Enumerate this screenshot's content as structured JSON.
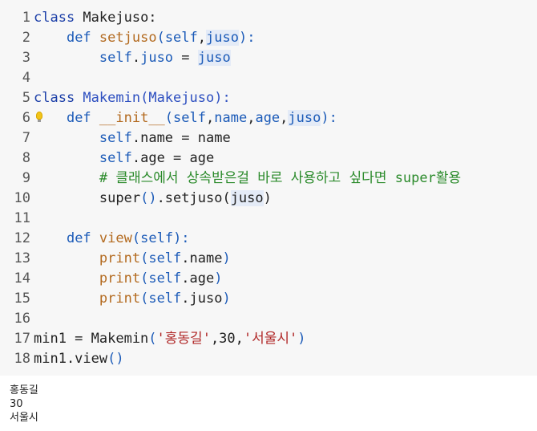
{
  "editor": {
    "lines": [
      {
        "num": "1",
        "tokens": [
          {
            "t": "class ",
            "c": "kw-cls"
          },
          {
            "t": "Makejuso:",
            "c": "pu"
          }
        ]
      },
      {
        "num": "2",
        "tokens": [
          {
            "t": "    ",
            "c": "pu"
          },
          {
            "t": "def ",
            "c": "kw-def"
          },
          {
            "t": "setjuso",
            "c": "slf"
          },
          {
            "t": "(",
            "c": "kw-def"
          },
          {
            "t": "self",
            "c": "kw-def"
          },
          {
            "t": ",",
            "c": "pu"
          },
          {
            "t": "juso",
            "c": "kw-def hl"
          },
          {
            "t": "):",
            "c": "kw-def"
          }
        ]
      },
      {
        "num": "3",
        "tokens": [
          {
            "t": "        ",
            "c": "pu"
          },
          {
            "t": "self",
            "c": "kw-def"
          },
          {
            "t": ".",
            "c": "pu"
          },
          {
            "t": "juso",
            "c": "kw-def"
          },
          {
            "t": " = ",
            "c": "pu"
          },
          {
            "t": "juso",
            "c": "kw-def hl"
          }
        ]
      },
      {
        "num": "4",
        "tokens": []
      },
      {
        "num": "5",
        "tokens": [
          {
            "t": "class ",
            "c": "kw-cls"
          },
          {
            "t": "Makemin",
            "c": "fn"
          },
          {
            "t": "(",
            "c": "fn"
          },
          {
            "t": "Makejuso",
            "c": "fn"
          },
          {
            "t": "):",
            "c": "fn"
          }
        ]
      },
      {
        "num": "6",
        "tokens": [
          {
            "t": "    ",
            "c": "pu"
          },
          {
            "t": "def ",
            "c": "kw-def"
          },
          {
            "t": "__init__",
            "c": "slf"
          },
          {
            "t": "(",
            "c": "kw-def"
          },
          {
            "t": "self",
            "c": "kw-def"
          },
          {
            "t": ",",
            "c": "pu"
          },
          {
            "t": "name",
            "c": "kw-def"
          },
          {
            "t": ",",
            "c": "pu"
          },
          {
            "t": "age",
            "c": "kw-def"
          },
          {
            "t": ",",
            "c": "pu"
          },
          {
            "t": "juso",
            "c": "kw-def hl"
          },
          {
            "t": "):",
            "c": "kw-def"
          }
        ],
        "bulb": true
      },
      {
        "num": "7",
        "tokens": [
          {
            "t": "        ",
            "c": "pu"
          },
          {
            "t": "self",
            "c": "kw-def"
          },
          {
            "t": ".",
            "c": "pu"
          },
          {
            "t": "name",
            "c": "pu"
          },
          {
            "t": " = ",
            "c": "pu"
          },
          {
            "t": "name",
            "c": "pu"
          }
        ]
      },
      {
        "num": "8",
        "tokens": [
          {
            "t": "        ",
            "c": "pu"
          },
          {
            "t": "self",
            "c": "kw-def"
          },
          {
            "t": ".",
            "c": "pu"
          },
          {
            "t": "age",
            "c": "pu"
          },
          {
            "t": " = ",
            "c": "pu"
          },
          {
            "t": "age",
            "c": "pu"
          }
        ]
      },
      {
        "num": "9",
        "tokens": [
          {
            "t": "        ",
            "c": "pu"
          },
          {
            "t": "# 클래스에서 상속받은걸 바로 사용하고 싶다면 super활용",
            "c": "cm"
          }
        ]
      },
      {
        "num": "10",
        "tokens": [
          {
            "t": "        ",
            "c": "pu"
          },
          {
            "t": "super",
            "c": "pu"
          },
          {
            "t": "()",
            "c": "kw-def"
          },
          {
            "t": ".setjuso(",
            "c": "pu"
          },
          {
            "t": "juso",
            "c": "pu hl"
          },
          {
            "t": ")",
            "c": "pu"
          }
        ]
      },
      {
        "num": "11",
        "tokens": []
      },
      {
        "num": "12",
        "tokens": [
          {
            "t": "    ",
            "c": "pu"
          },
          {
            "t": "def ",
            "c": "kw-def"
          },
          {
            "t": "view",
            "c": "slf"
          },
          {
            "t": "(",
            "c": "kw-def"
          },
          {
            "t": "self",
            "c": "kw-def"
          },
          {
            "t": "):",
            "c": "kw-def"
          }
        ]
      },
      {
        "num": "13",
        "tokens": [
          {
            "t": "        ",
            "c": "pu"
          },
          {
            "t": "print",
            "c": "slf"
          },
          {
            "t": "(",
            "c": "kw-def"
          },
          {
            "t": "self",
            "c": "kw-def"
          },
          {
            "t": ".name",
            "c": "pu"
          },
          {
            "t": ")",
            "c": "kw-def"
          }
        ]
      },
      {
        "num": "14",
        "tokens": [
          {
            "t": "        ",
            "c": "pu"
          },
          {
            "t": "print",
            "c": "slf"
          },
          {
            "t": "(",
            "c": "kw-def"
          },
          {
            "t": "self",
            "c": "kw-def"
          },
          {
            "t": ".age",
            "c": "pu"
          },
          {
            "t": ")",
            "c": "kw-def"
          }
        ]
      },
      {
        "num": "15",
        "tokens": [
          {
            "t": "        ",
            "c": "pu"
          },
          {
            "t": "print",
            "c": "slf"
          },
          {
            "t": "(",
            "c": "kw-def"
          },
          {
            "t": "self",
            "c": "kw-def"
          },
          {
            "t": ".juso",
            "c": "pu"
          },
          {
            "t": ")",
            "c": "kw-def"
          }
        ]
      },
      {
        "num": "16",
        "tokens": []
      },
      {
        "num": "17",
        "tokens": [
          {
            "t": "min1 = Makemin",
            "c": "pu"
          },
          {
            "t": "(",
            "c": "kw-def"
          },
          {
            "t": "'홍동길'",
            "c": "st"
          },
          {
            "t": ",30,",
            "c": "pu"
          },
          {
            "t": "'서울시'",
            "c": "st"
          },
          {
            "t": ")",
            "c": "kw-def"
          }
        ]
      },
      {
        "num": "18",
        "tokens": [
          {
            "t": "min1.view",
            "c": "pu"
          },
          {
            "t": "()",
            "c": "kw-def"
          }
        ]
      }
    ]
  },
  "output": {
    "lines": [
      "홍동길",
      "30",
      "서울시"
    ]
  },
  "colors": {
    "editor_bg": "#f7f7f7",
    "keyword": "#1c5bb8",
    "function_name": "#b36a1f",
    "comment": "#2a8a2a",
    "string": "#b02828"
  }
}
